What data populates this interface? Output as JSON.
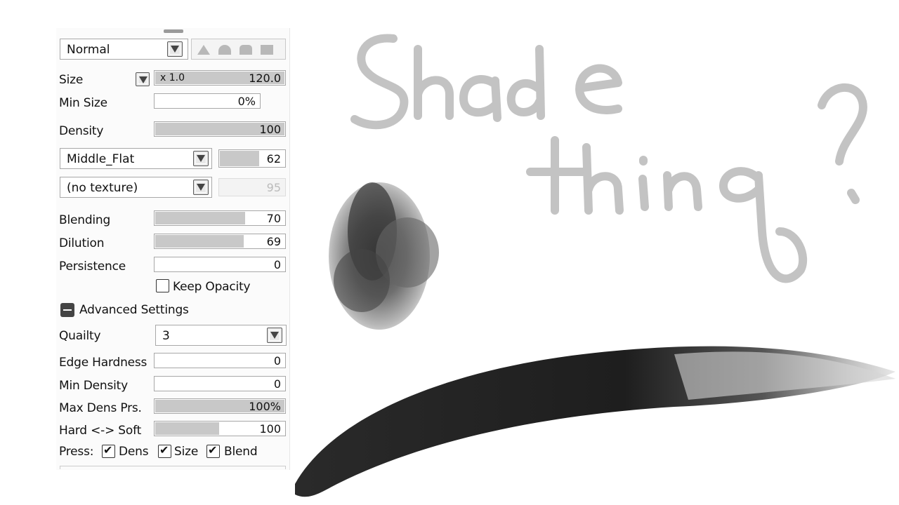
{
  "panel": {
    "blend_mode": "Normal",
    "size": {
      "label": "Size",
      "multiplier": "x 1.0",
      "value": "120.0"
    },
    "min_size": {
      "label": "Min Size",
      "value": "0%"
    },
    "density": {
      "label": "Density",
      "value": "100",
      "level": 1.0
    },
    "brush_shape": {
      "name": "Middle_Flat",
      "value": "62",
      "level": 0.62
    },
    "texture": {
      "name": "(no texture)",
      "value": "95"
    },
    "blending": {
      "label": "Blending",
      "value": "70",
      "level": 0.7
    },
    "dilution": {
      "label": "Dilution",
      "value": "69",
      "level": 0.69
    },
    "persistence": {
      "label": "Persistence",
      "value": "0",
      "level": 0
    },
    "keep_opacity": "Keep Opacity",
    "advanced": "Advanced Settings",
    "quality": {
      "label": "Quailty",
      "value": "3"
    },
    "edge_hardness": {
      "label": "Edge Hardness",
      "value": "0"
    },
    "min_density": {
      "label": "Min Density",
      "value": "0"
    },
    "max_dens_prs": {
      "label": "Max Dens Prs.",
      "value": "100%",
      "level": 1.0
    },
    "hard_soft": {
      "label": "Hard <-> Soft",
      "value": "100",
      "level": 0.5
    },
    "press": {
      "label": "Press:",
      "dens": "Dens",
      "size": "Size",
      "blend": "Blend"
    }
  },
  "canvas": {
    "handwriting_line1": "Shade",
    "handwriting_line2": "thing?"
  }
}
